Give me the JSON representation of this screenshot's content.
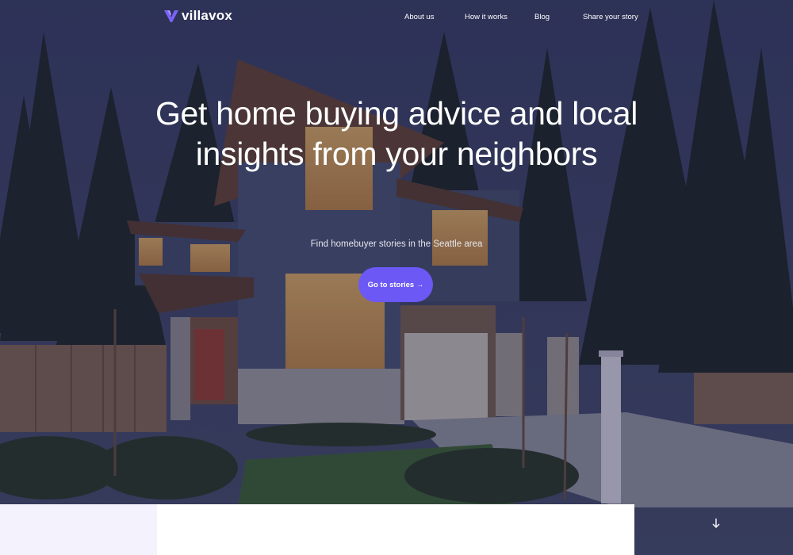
{
  "brand": {
    "name": "villavox",
    "accent": "#6b58f5"
  },
  "nav": {
    "links": [
      {
        "label": "About us"
      },
      {
        "label": "How it works"
      },
      {
        "label": "Blog"
      },
      {
        "label": "Share your story"
      }
    ]
  },
  "hero": {
    "headline_line1": "Get home buying advice and local",
    "headline_line2": "insights from your neighbors",
    "subline": "Find homebuyer stories in the Seattle area",
    "cta_label": "Go to stories →"
  },
  "icons": {
    "scroll": "arrow-down-icon",
    "logo": "v-logo-icon"
  }
}
